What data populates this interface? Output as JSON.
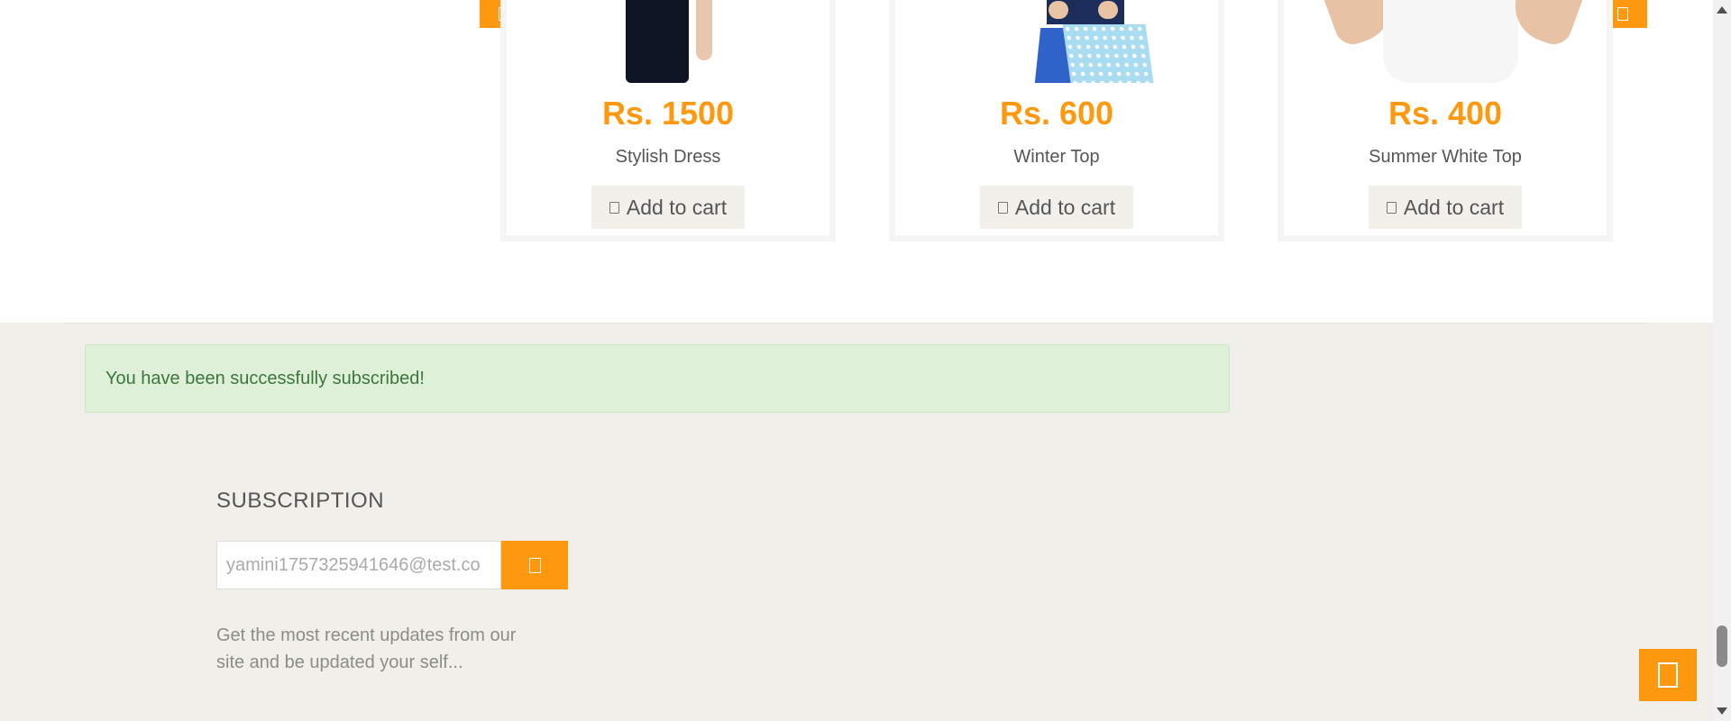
{
  "products": [
    {
      "price": "Rs. 1500",
      "name": "Stylish Dress",
      "cart_label": "Add to cart"
    },
    {
      "price": "Rs. 600",
      "name": "Winter Top",
      "cart_label": "Add to cart"
    },
    {
      "price": "Rs. 400",
      "name": "Summer White Top",
      "cart_label": "Add to cart"
    }
  ],
  "alert": {
    "message": "You have been successfully subscribed!"
  },
  "subscription": {
    "title": "SUBSCRIPTION",
    "email_value": "yamini1757325941646@test.co",
    "description": "Get the most recent updates from our site and be updated your self..."
  },
  "colors": {
    "accent": "#fe980f",
    "alert_bg": "#dff0d8",
    "alert_text": "#3c763d",
    "footer_bg": "#f0efe9"
  }
}
